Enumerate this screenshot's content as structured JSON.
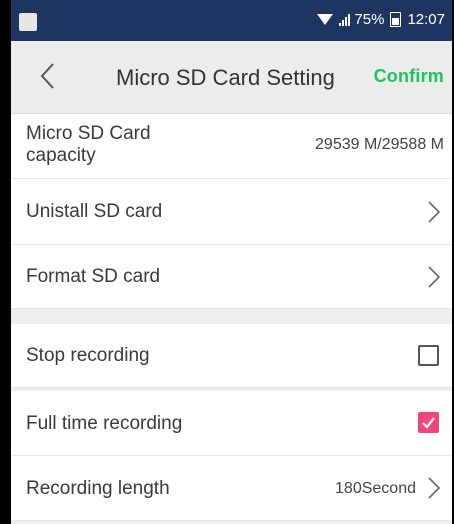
{
  "status_bar": {
    "battery": "75%",
    "time": "12:07"
  },
  "toolbar": {
    "title": "Micro SD Card Setting",
    "confirm_label": "Confirm"
  },
  "capacity": {
    "label_line1": "Micro SD Card",
    "label_line2": "capacity",
    "value": "29539 M/29588 M"
  },
  "items": {
    "uninstall": "Unistall SD card",
    "format": "Format SD card",
    "stop_recording": "Stop recording",
    "full_time_recording": "Full time recording",
    "recording_length": "Recording length",
    "recording_length_value": "180Second"
  },
  "checkbox_states": {
    "stop_recording": false,
    "full_time_recording": true
  },
  "colors": {
    "status_bar": "#1f3561",
    "confirm": "#1ec45a",
    "checkbox_checked": "#f2457a"
  }
}
